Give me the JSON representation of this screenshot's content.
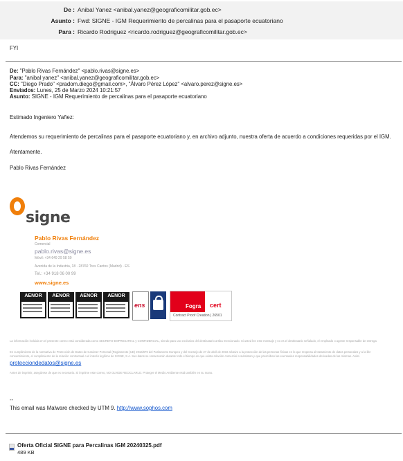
{
  "forward_header": {
    "from_label": "De :",
    "from_value": "Anibal Yanez <anibal.yanez@geograficomilitar.gob.ec>",
    "subject_label": "Asunto :",
    "subject_value": "Fwd: SIGNE - IGM Requerimiento de percalinas para el pasaporte ecuatoriano",
    "to_label": "Para :",
    "to_value": "Ricardo Rodriguez <ricardo.rodriguez@geograficomilitar.gob.ec>"
  },
  "fyi": "FYI",
  "original": {
    "from_label": "De:",
    "from_value": "\"Pablo Rivas Fernández\" <pablo.rivas@signe.es>",
    "to_label": "Para:",
    "to_value": "\"anibal yanez\" <anibal.yanez@geograficomilitar.gob.ec>",
    "cc_label": "CC:",
    "cc_value": "\"Diego Prado\" <pradom.diego@gmail.com>, \"Álvaro Pérez López\" <alvaro.perez@signe.es>",
    "sent_label": "Enviados:",
    "sent_value": "Lunes, 25 de Marzo 2024 10:21:57",
    "subject_label": "Asunto:",
    "subject_value": "SIGNE - IGM Requerimiento de percalinas para el pasaporte ecuatoriano"
  },
  "body": {
    "greeting": "Estimado Ingeniero Yañez:",
    "paragraph": "Atendemos su requerimiento de percalinas para el pasaporte ecuatoriano y, en archivo adjunto, nuestra oferta de acuerdo a condiciones requeridas por el IGM.",
    "closing": "Atentamente.",
    "signer": "Pablo Rivas Fernández"
  },
  "signature": {
    "logo_text": "signe",
    "name": "Pablo Rivas Fernández",
    "role": "Comercial",
    "email": "pablo.rivas@signe.es",
    "mobile": "Móvil: +34 649 29 58 59",
    "address": "Avenida de la Industria, 18 · 28760 Tres Cantos (Madrid) · ES",
    "phone": "Tel.: +34 918 06 00 99",
    "web": "www.signe.es",
    "badges": [
      "AENOR",
      "AENOR",
      "AENOR",
      "AENOR"
    ],
    "badge_sub": [
      "GESTIÓN DE LA CALIDAD",
      "GESTIÓN AMBIENTAL",
      "SEGURIDAD INFORMACIÓN",
      "IMPRESIÓN DE SEGURIDAD"
    ],
    "ens": "ens",
    "fogra_text": "Fogra",
    "cert_text": "cert",
    "fogra_bottom": "Contract Proof Creation | 26501"
  },
  "disclaimer": {
    "line1": "La información incluida en el presente correo está considerada como SECRETO EMPRESARIAL y CONFIDENCIAL, siendo para uso exclusivo del destinatario arriba mencionado. Si usted lee este mensaje y no es el destinatario señalado, el empleado o agente responsable de entrega",
    "line2": "En cumplimiento de la normativa de Protección de Datos de Carácter Personal (Reglamento (UE) 2016/679 del Parlamento Europeo y del Consejo de 27 de abril de 2016 relativo a la protección de las personas físicas en lo que respecta al tratamiento de datos personales y a la libr",
    "line3": "consentimiento, el cumplimiento de la relación contractual o el interés legítimo de SIGNE, S.A. Sus datos se conservarán durante todo el tiempo en que exista relación comercial o subsistan y que prescriban las eventuales responsabilidades derivadas de las mismas. Asimi",
    "link": "protecciondedatos@signe.es",
    "line4": "Antes de imprimir, asegúrese de que es necesario. Si imprime este correo, NO OLVIDE RECICLARLO. Proteger el Medio Ambiente está también en su mano."
  },
  "footer": {
    "dashes": "--",
    "malware_text": "This email was Malware checked by UTM 9.",
    "malware_link": "http://www.sophos.com"
  },
  "attachment": {
    "icon": "pdf-file-icon",
    "name": "Oferta Oficial SIGNE para Percalinas IGM 20240325.pdf",
    "size": "489 KB"
  }
}
